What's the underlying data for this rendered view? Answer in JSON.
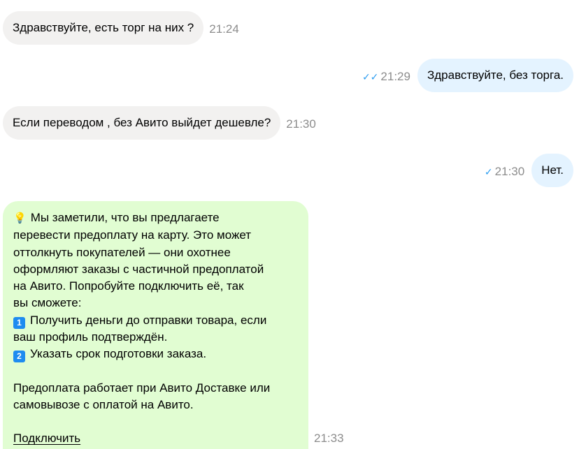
{
  "messages": [
    {
      "text": "Здравствуйте, есть торг на них ?",
      "time": "21:24"
    },
    {
      "text": "Здравствуйте, без торга.",
      "time": "21:29",
      "status": "double-check-icon"
    },
    {
      "text": "Если переводом , без Авито выйдет дешевле?",
      "time": "21:30"
    },
    {
      "text": "Нет.",
      "time": "21:30",
      "status": "single-check-icon"
    }
  ],
  "notice": {
    "lines": [
      "Мы заметили, что вы предлагаете",
      "перевести предоплату на карту. Это может",
      "оттолкнуть покупателей — они охотнее",
      "оформляют заказы с частичной предоплатой",
      "на Авито. Попробуйте подключить её, так",
      "вы сможете:"
    ],
    "item1_line1": "Получить деньги до отправки товара, если",
    "item1_line2": "ваш профиль подтверждён.",
    "item2": "Указать срок подготовки заказа.",
    "footer_line1": "Предоплата работает при Авито Доставке или",
    "footer_line2": "самовывозе с оплатой на Авито.",
    "link": "Подключить",
    "time": "21:33",
    "num1": "1",
    "num2": "2"
  },
  "colors": {
    "incoming_bubble": "#f2f1f0",
    "outgoing_bubble": "#e4f3ff",
    "notice_bubble": "#e1fdd2",
    "check": "#2a9cf0",
    "time": "#8c8c8c"
  }
}
